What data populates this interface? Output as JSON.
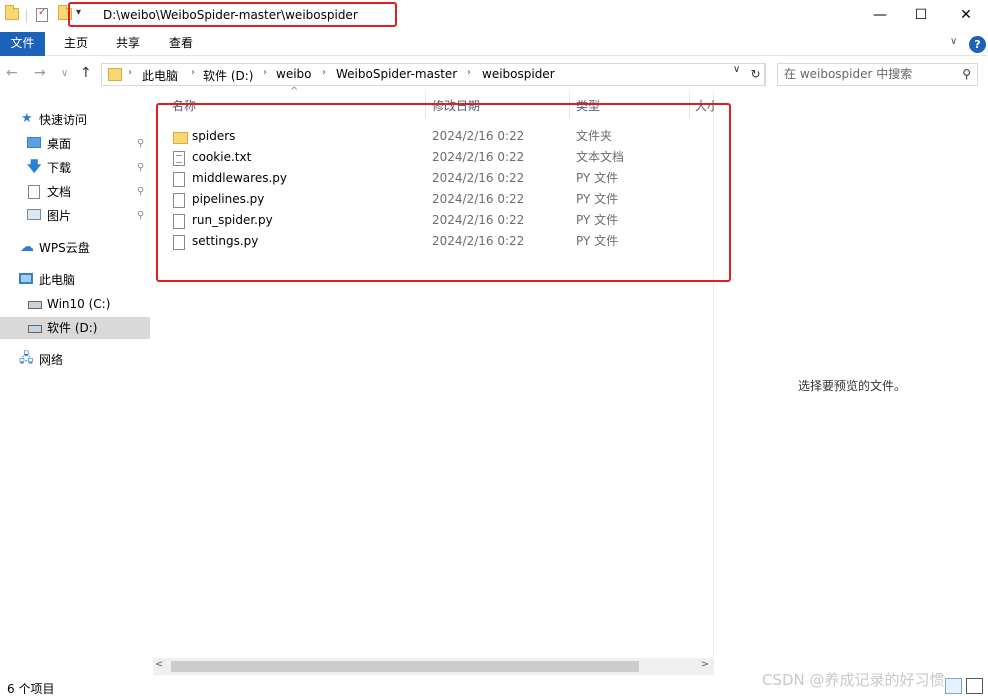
{
  "titlebar": {
    "path": "D:\\weibo\\WeiboSpider-master\\weibospider",
    "dropdown": "▾",
    "minimize": "—",
    "maximize": "☐",
    "close": "✕"
  },
  "ribbon": {
    "tabs": [
      "文件",
      "主页",
      "共享",
      "查看"
    ],
    "collapse": "∨",
    "help": "?"
  },
  "nav": {
    "back": "←",
    "forward": "→",
    "recent": "∨",
    "up": "↑",
    "breadcrumbs": [
      "此电脑",
      "软件 (D:)",
      "weibo",
      "WeiboSpider-master",
      "weibospider"
    ],
    "separator": "›",
    "dropdown": "∨",
    "refresh": "↻",
    "search_placeholder": "在 weibospider 中搜索",
    "search_icon": "⚲"
  },
  "sidebar": {
    "items": [
      {
        "label": "快速访问",
        "icon": "star-icon"
      },
      {
        "label": "桌面",
        "icon": "desktop-icon",
        "pinned": true
      },
      {
        "label": "下载",
        "icon": "download-icon",
        "pinned": true
      },
      {
        "label": "文档",
        "icon": "document-icon",
        "pinned": true
      },
      {
        "label": "图片",
        "icon": "pictures-icon",
        "pinned": true
      },
      {
        "label": "WPS云盘",
        "icon": "cloud-icon"
      },
      {
        "label": "此电脑",
        "icon": "computer-icon"
      },
      {
        "label": "Win10 (C:)",
        "icon": "drive-icon"
      },
      {
        "label": "软件 (D:)",
        "icon": "drive-icon",
        "selected": true
      },
      {
        "label": "网络",
        "icon": "network-icon"
      }
    ],
    "pin_glyph": "📌"
  },
  "filelist": {
    "columns": {
      "name": "名称",
      "modified": "修改日期",
      "type": "类型",
      "size": "大小"
    },
    "sort_glyph": "^",
    "rows": [
      {
        "name": "spiders",
        "modified": "2024/2/16 0:22",
        "type": "文件夹",
        "kind": "folder"
      },
      {
        "name": "cookie.txt",
        "modified": "2024/2/16 0:22",
        "type": "文本文档",
        "kind": "txt"
      },
      {
        "name": "middlewares.py",
        "modified": "2024/2/16 0:22",
        "type": "PY 文件",
        "kind": "py"
      },
      {
        "name": "pipelines.py",
        "modified": "2024/2/16 0:22",
        "type": "PY 文件",
        "kind": "py"
      },
      {
        "name": "run_spider.py",
        "modified": "2024/2/16 0:22",
        "type": "PY 文件",
        "kind": "py"
      },
      {
        "name": "settings.py",
        "modified": "2024/2/16 0:22",
        "type": "PY 文件",
        "kind": "py"
      }
    ]
  },
  "scroll": {
    "left": "<",
    "right": ">"
  },
  "preview": {
    "message": "选择要预览的文件。"
  },
  "status": {
    "count": "6 个项目"
  },
  "watermark": "CSDN @养成记录的好习惯",
  "colors": {
    "accent": "#1a63b8",
    "highlight": "#e02020"
  }
}
